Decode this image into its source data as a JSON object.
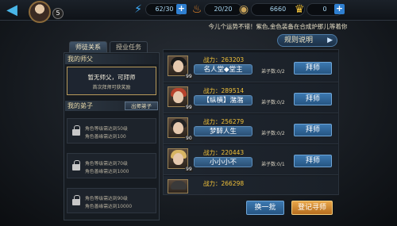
{
  "topbar": {
    "level": "5",
    "stamina": "62/30",
    "energy": "20/20",
    "coins": "6660",
    "gold": "0"
  },
  "marquee": "今儿个运势不错！紫色,金色装备在合成炉那儿等着你",
  "tabs": [
    {
      "label": "师徒关系",
      "active": true
    },
    {
      "label": "授业任务",
      "active": false
    }
  ],
  "rules_label": "规则说明",
  "left": {
    "master_header": "我的师父",
    "no_master": "暂无师父，可拜师",
    "first_bonus": "首次拜师可获奖励",
    "disciples_header": "我的弟子",
    "graduate_label": "出师弟子",
    "slots": [
      {
        "req": "角色等级需达到50级",
        "sub": "角色善缘需达到100"
      },
      {
        "req": "角色等级需达到70级",
        "sub": "角色善缘需达到1000"
      },
      {
        "req": "角色等级需达到90级",
        "sub": "角色善缘需达到10000"
      }
    ]
  },
  "list": {
    "power_prefix": "战力：",
    "apprentice_label": "拜师",
    "rows": [
      {
        "power": "263203",
        "name": "名人堂◆堂主",
        "disciples": "弟子数:0/2",
        "level": "99",
        "hair": "#1a1a1a"
      },
      {
        "power": "289514",
        "name": "【纵横】潴潴",
        "disciples": "弟子数:0/2",
        "level": "99",
        "hair": "#b8432c"
      },
      {
        "power": "256279",
        "name": "梦醉人生",
        "disciples": "弟子数:0/2",
        "level": "90",
        "hair": "#222222"
      },
      {
        "power": "220443",
        "name": "小小小不",
        "disciples": "弟子数:0/1",
        "level": "99",
        "hair": "#d7b563"
      },
      {
        "power": "266298",
        "name": "",
        "disciples": "",
        "level": "",
        "hair": "#3a3a3a"
      }
    ]
  },
  "buttons": {
    "refresh": "换一批",
    "register": "登记寻师"
  }
}
